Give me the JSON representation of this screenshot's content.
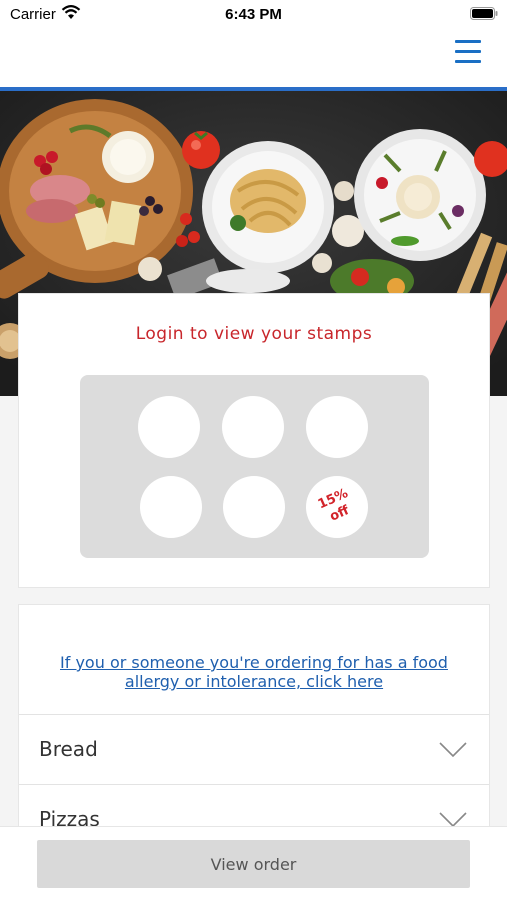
{
  "status_bar": {
    "carrier": "Carrier",
    "time": "6:43 PM",
    "icons": [
      "wifi-icon",
      "battery-icon"
    ]
  },
  "header": {
    "menu_icon": "hamburger-icon",
    "accent_color": "#2a6ec8"
  },
  "hero": {
    "description_icon": "food-spread-image"
  },
  "stamps": {
    "title": "Login to view your stamps",
    "title_color": "#c8262b",
    "total": 6,
    "reward_line1": "15%",
    "reward_line2": "off",
    "reward_color": "#d2232a"
  },
  "menu": {
    "allergy_link": "If you or someone you're ordering for has a food allergy or intolerance, click here",
    "link_color": "#1f5fae",
    "categories": [
      {
        "label": "Bread",
        "icon": "chevron-down-icon"
      },
      {
        "label": "Pizzas",
        "icon": "chevron-down-icon"
      }
    ]
  },
  "footer": {
    "view_order_label": "View order"
  }
}
